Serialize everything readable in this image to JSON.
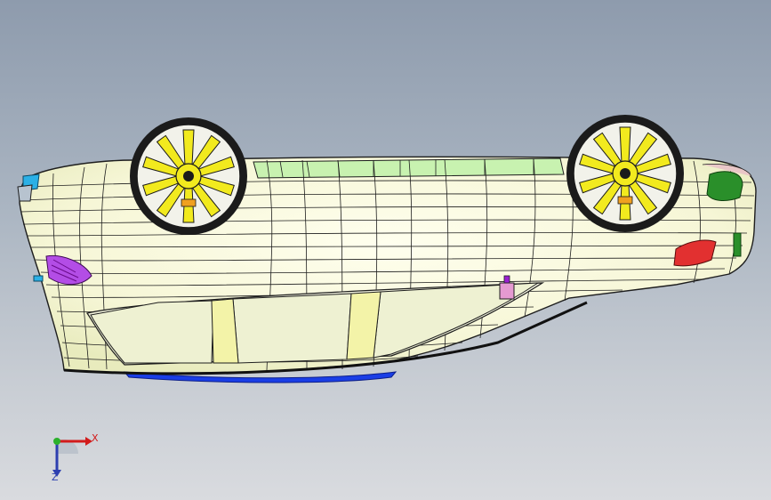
{
  "viewport": {
    "background_top": "#8e9bad",
    "background_bottom": "#d9dbdf"
  },
  "model": {
    "body_color": "#fbfbe2",
    "body_shadow_color": "#eef0c4",
    "trim_green_color": "#c8f2b0",
    "underbody_color": "#eef1d2",
    "pillar_color": "#f3f3a8",
    "wheel_spoke_color": "#f2ea1e",
    "tire_color": "#1b1b1b",
    "front_lamp_color": "#9b1fd1",
    "rear_lamp_color": "#e23030",
    "indicator_color": "#2bb0e6",
    "mirror_color": "#2a8f2a",
    "skirt_color": "#1a3ee6",
    "mesh_line_color": "#1e1e1e"
  },
  "triad": {
    "x_label": "X",
    "z_label": "Z",
    "x_color": "#d21b1b",
    "y_color": "#2bb02b",
    "z_color": "#2d3fb0"
  }
}
